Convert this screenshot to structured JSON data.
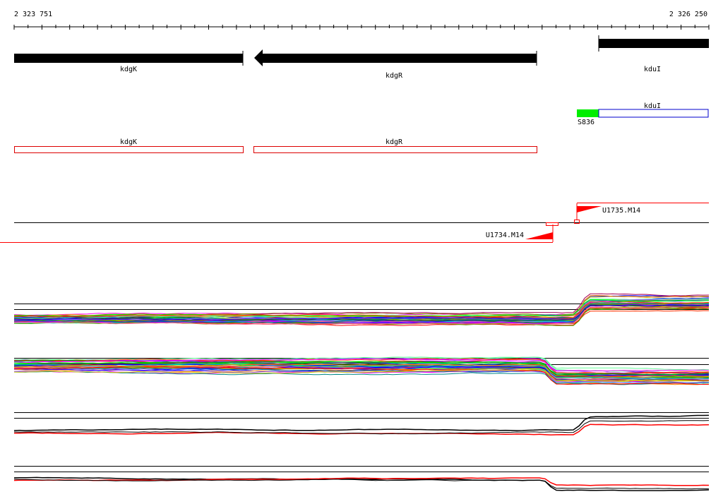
{
  "ruler": {
    "start_label": "2 323 751",
    "end_label": "2 326 250"
  },
  "genes": [
    {
      "name": "kdgK",
      "strand": "+"
    },
    {
      "name": "kdgR",
      "strand": "-"
    },
    {
      "name": "kduI",
      "strand": "+"
    }
  ],
  "utr_track": {
    "promoter_label": "S836",
    "feature_label": "kduI",
    "colors": {
      "promoter": "#00ee00",
      "feature": "#0000cc"
    }
  },
  "cds_track": {
    "labels": [
      "kdgK",
      "kdgR"
    ],
    "color": "#dd0000"
  },
  "transcripts": [
    {
      "name": "U1735.M14",
      "strand": "+"
    },
    {
      "name": "U1734.M14",
      "strand": "-"
    }
  ],
  "expression_panels": [
    {
      "id": "multi-plus",
      "style": "multicolor",
      "shift": "up-near-kduI"
    },
    {
      "id": "multi-minus",
      "style": "multicolor",
      "shift": "down-near-kduI"
    },
    {
      "id": "summary-plus",
      "style": "black-red",
      "shift": "up-near-kduI"
    },
    {
      "id": "summary-minus",
      "style": "black-red",
      "shift": "down-near-kduI"
    }
  ],
  "colors": {
    "gene": "#000000",
    "transcript": "#ff0000",
    "axis": "#000000"
  }
}
